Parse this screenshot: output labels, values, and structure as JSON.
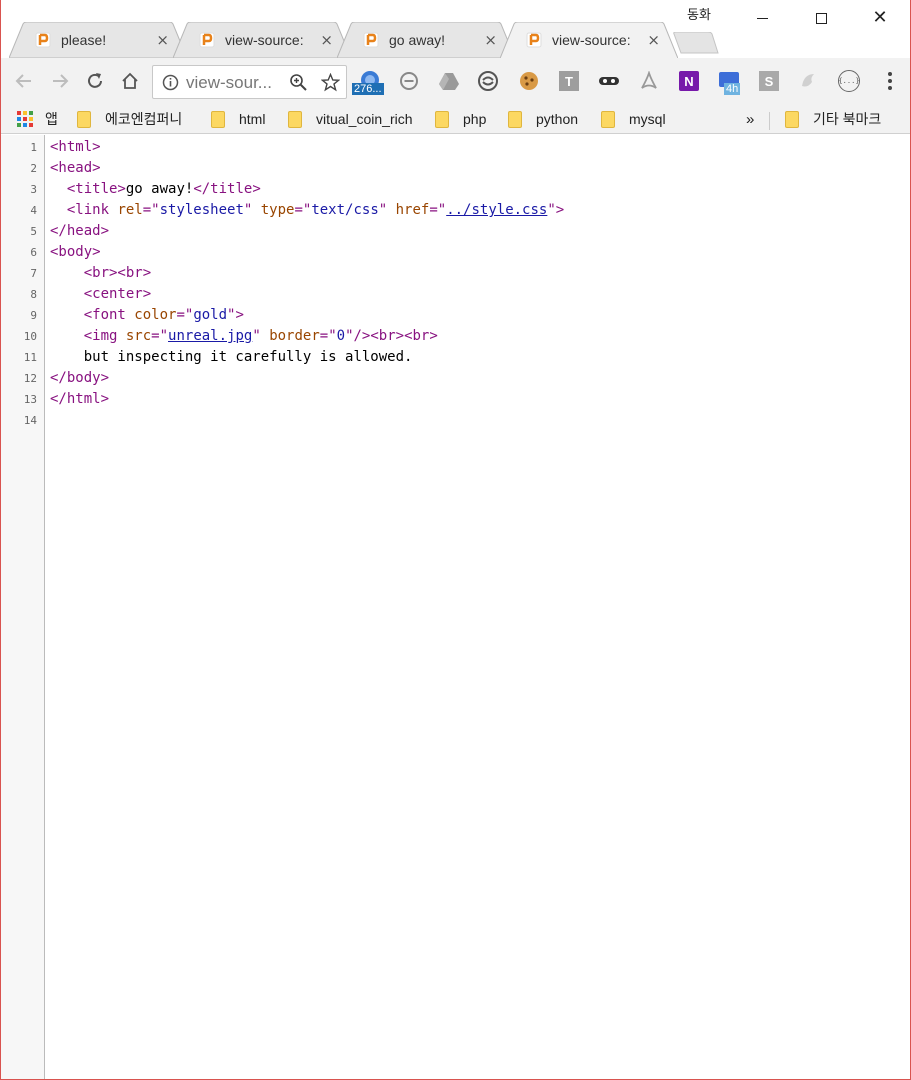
{
  "window": {
    "user_label": "동화",
    "minimize_glyph": "—",
    "maximize_glyph": "□",
    "close_glyph": "✕"
  },
  "tabs": [
    {
      "title": "please!",
      "active": false
    },
    {
      "title": "view-source:",
      "active": false
    },
    {
      "title": "go away!",
      "active": false
    },
    {
      "title": "view-source:",
      "active": true
    }
  ],
  "tab_close_glyph": "×",
  "toolbar": {
    "url_display": "view-sour...",
    "extensions": [
      {
        "name": "badge-counter-extension",
        "badge": "276..."
      },
      {
        "name": "block-extension"
      },
      {
        "name": "drive-extension"
      },
      {
        "name": "sync-extension"
      },
      {
        "name": "cookie-extension"
      },
      {
        "name": "t-extension",
        "letter": "T"
      },
      {
        "name": "mask-extension"
      },
      {
        "name": "acrobat-extension"
      },
      {
        "name": "onenote-extension",
        "letter": "N"
      },
      {
        "name": "timer-extension",
        "badge": "4h"
      },
      {
        "name": "s-extension",
        "letter": "S"
      },
      {
        "name": "swirl-extension"
      },
      {
        "name": "code-extension",
        "letter": "{...}"
      }
    ]
  },
  "bookmarks": {
    "apps_label": "앱",
    "items": [
      "에코엔컴퍼니",
      "html",
      "vitual_coin_rich",
      "php",
      "python",
      "mysql"
    ],
    "overflow": "»",
    "other_label": "기타 북마크"
  },
  "source": {
    "line_numbers": [
      "1",
      "2",
      "3",
      "4",
      "5",
      "6",
      "7",
      "8",
      "9",
      "10",
      "11",
      "12",
      "13",
      "14"
    ],
    "lines": [
      {
        "indent": "",
        "parts": [
          {
            "k": "t",
            "s": "<html>"
          }
        ]
      },
      {
        "indent": "",
        "parts": [
          {
            "k": "t",
            "s": "<head>"
          }
        ]
      },
      {
        "indent": "  ",
        "parts": [
          {
            "k": "t",
            "s": "<title>"
          },
          {
            "k": "x",
            "s": "go away!"
          },
          {
            "k": "t",
            "s": "</title>"
          }
        ]
      },
      {
        "indent": "  ",
        "parts": [
          {
            "k": "t",
            "s": "<link "
          },
          {
            "k": "a",
            "s": "rel"
          },
          {
            "k": "t",
            "s": "=\""
          },
          {
            "k": "v",
            "s": "stylesheet"
          },
          {
            "k": "t",
            "s": "\" "
          },
          {
            "k": "a",
            "s": "type"
          },
          {
            "k": "t",
            "s": "=\""
          },
          {
            "k": "v",
            "s": "text/css"
          },
          {
            "k": "t",
            "s": "\" "
          },
          {
            "k": "a",
            "s": "href"
          },
          {
            "k": "t",
            "s": "=\""
          },
          {
            "k": "lk",
            "s": "../style.css"
          },
          {
            "k": "t",
            "s": "\">"
          }
        ]
      },
      {
        "indent": "",
        "parts": [
          {
            "k": "t",
            "s": "</head>"
          }
        ]
      },
      {
        "indent": "",
        "parts": [
          {
            "k": "t",
            "s": "<body>"
          }
        ]
      },
      {
        "indent": "    ",
        "parts": [
          {
            "k": "t",
            "s": "<br><br>"
          }
        ]
      },
      {
        "indent": "    ",
        "parts": [
          {
            "k": "t",
            "s": "<center>"
          }
        ]
      },
      {
        "indent": "    ",
        "parts": [
          {
            "k": "t",
            "s": "<font "
          },
          {
            "k": "a",
            "s": "color"
          },
          {
            "k": "t",
            "s": "=\""
          },
          {
            "k": "v",
            "s": "gold"
          },
          {
            "k": "t",
            "s": "\">"
          }
        ]
      },
      {
        "indent": "    ",
        "parts": [
          {
            "k": "t",
            "s": "<img "
          },
          {
            "k": "a",
            "s": "src"
          },
          {
            "k": "t",
            "s": "=\""
          },
          {
            "k": "lk",
            "s": "unreal.jpg"
          },
          {
            "k": "t",
            "s": "\" "
          },
          {
            "k": "a",
            "s": "border"
          },
          {
            "k": "t",
            "s": "=\""
          },
          {
            "k": "v",
            "s": "0"
          },
          {
            "k": "t",
            "s": "\"/><br><br>"
          }
        ]
      },
      {
        "indent": "    ",
        "parts": [
          {
            "k": "x",
            "s": "but inspecting it carefully is allowed."
          }
        ]
      },
      {
        "indent": "",
        "parts": [
          {
            "k": "t",
            "s": "</body>"
          }
        ]
      },
      {
        "indent": "",
        "parts": [
          {
            "k": "t",
            "s": "</html>"
          }
        ]
      },
      {
        "indent": "",
        "parts": []
      }
    ]
  }
}
